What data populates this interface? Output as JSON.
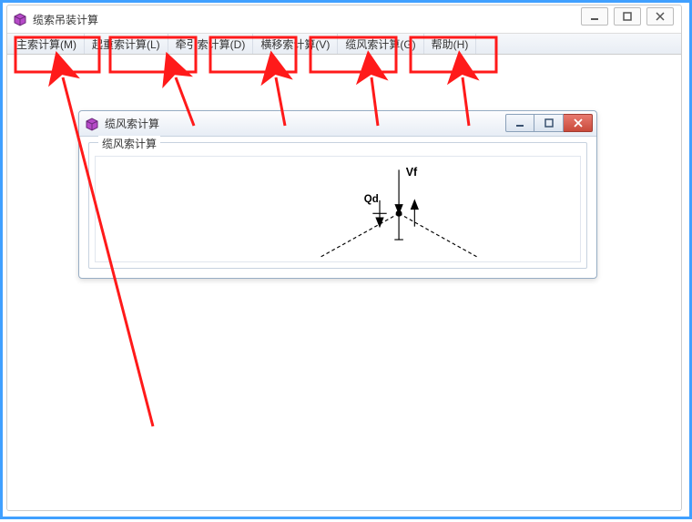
{
  "outer_window": {
    "title": "缆索吊装计算"
  },
  "menu": {
    "items": [
      "主索计算(M)",
      "起重索计算(L)",
      "牵引索计算(D)",
      "横移索计算(V)",
      "缆风索计算(G)",
      "帮助(H)"
    ]
  },
  "inner_window": {
    "title": "缆风索计算",
    "group_label": "缆风索计算"
  },
  "diagram": {
    "label_v": "Vf",
    "label_q": "Qd"
  }
}
